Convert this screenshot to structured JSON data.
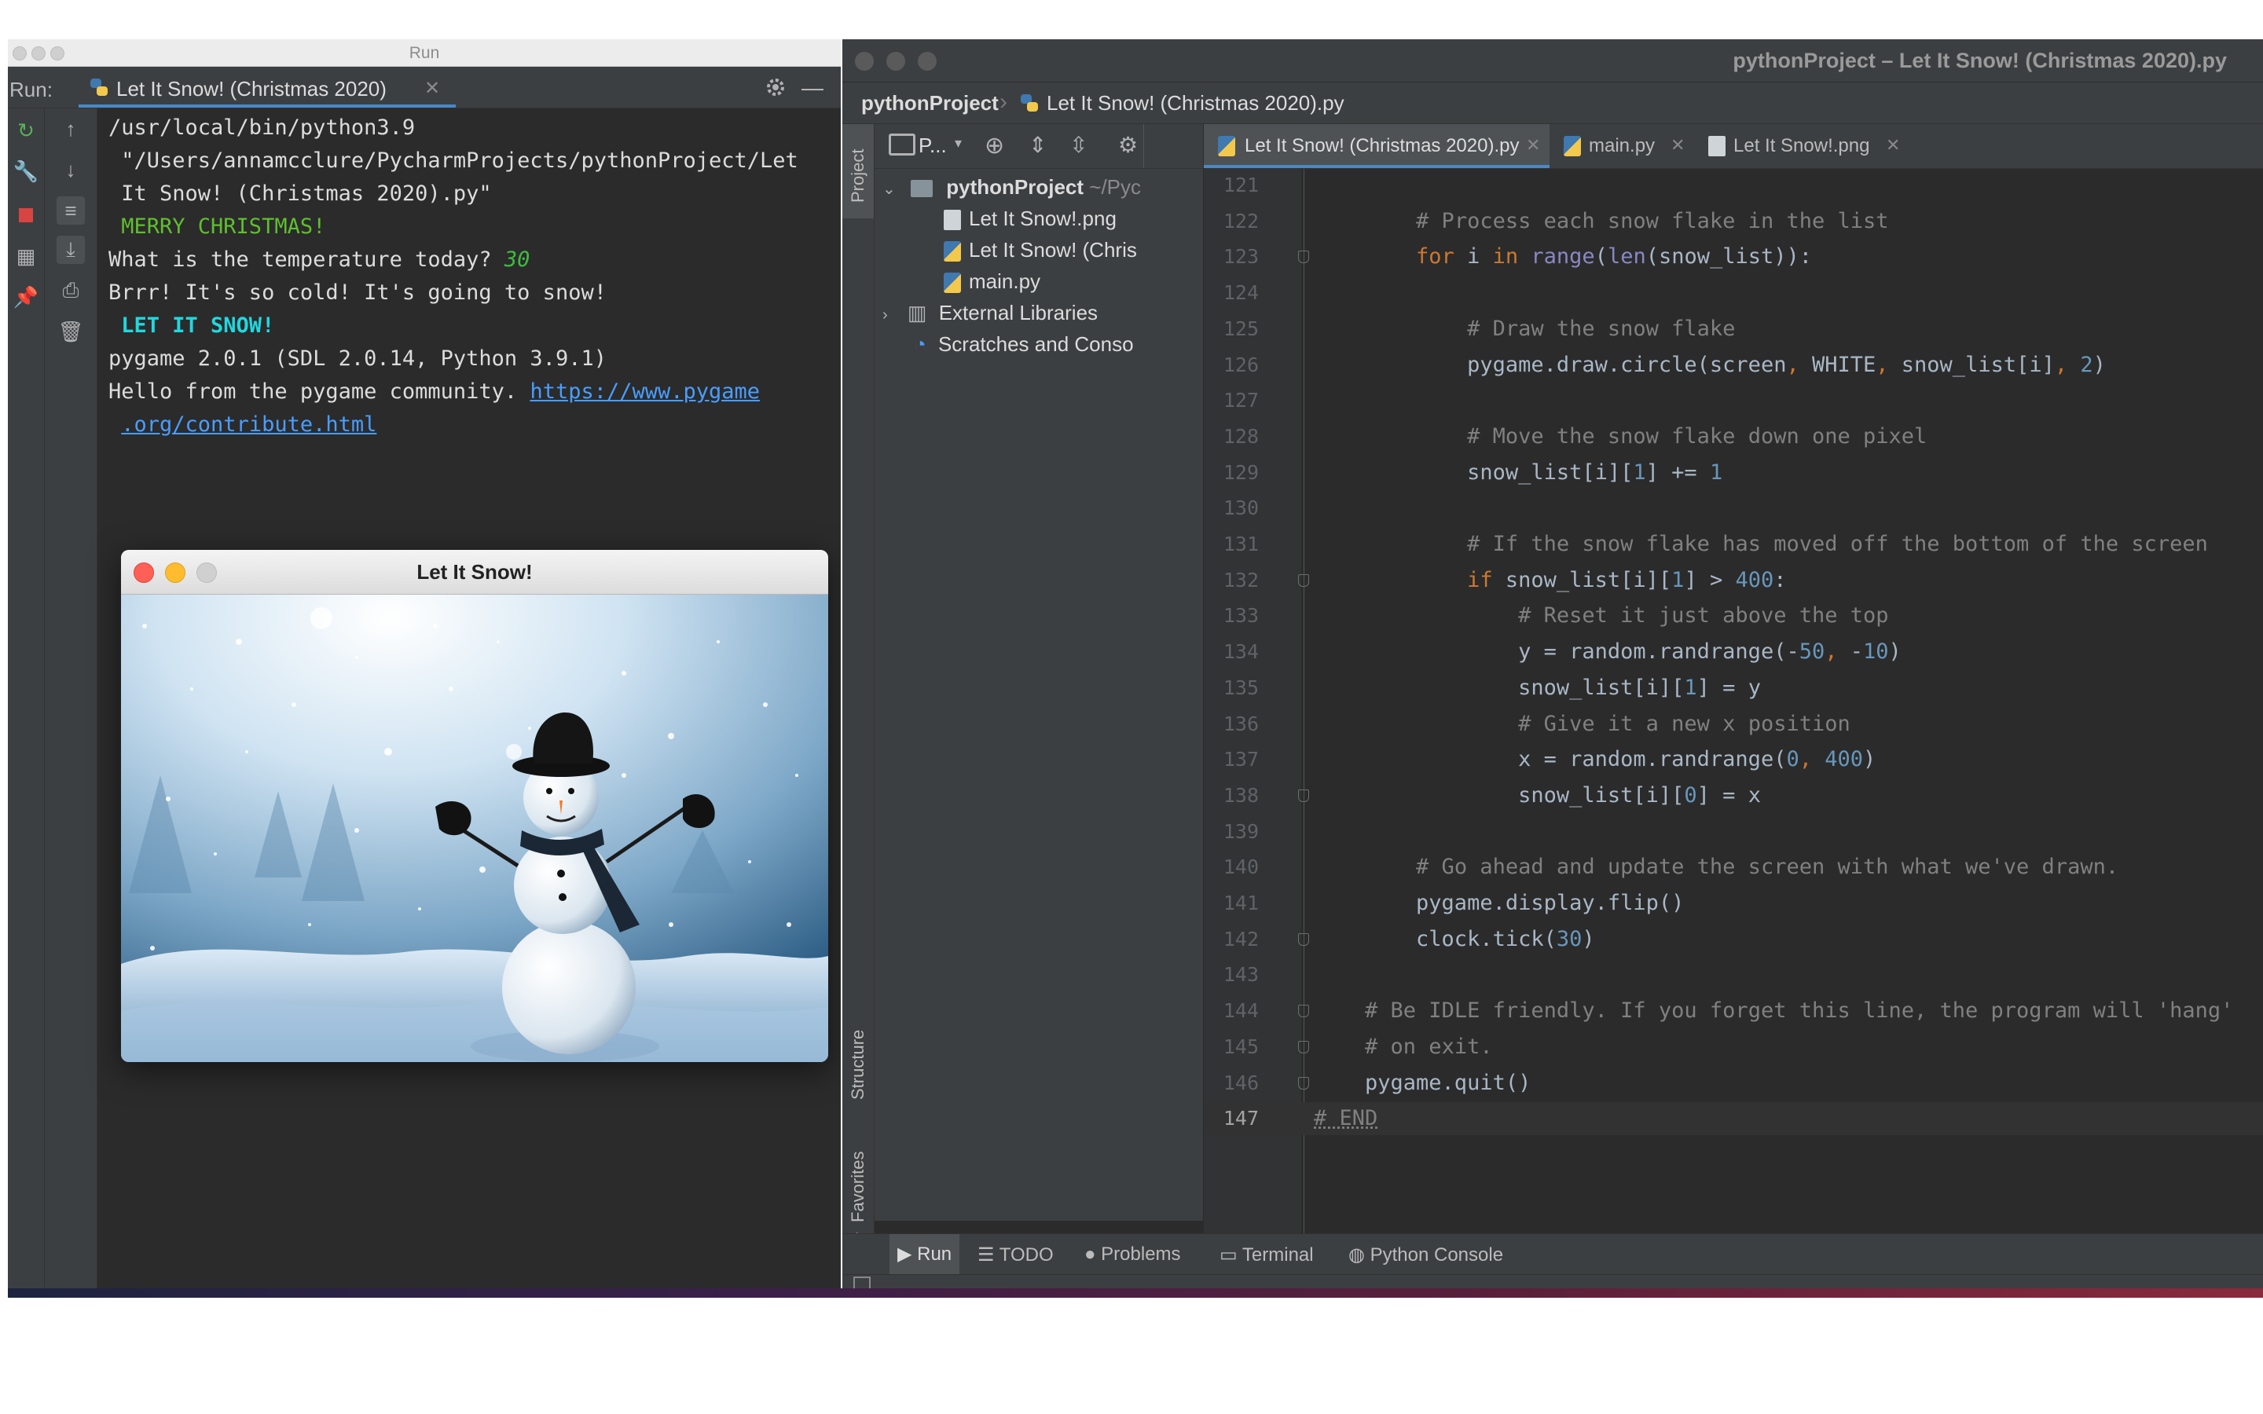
{
  "run_window": {
    "title": "Run",
    "run_label": "Run:",
    "tab_label": "Let It Snow! (Christmas 2020)",
    "console_lines": [
      {
        "text": "/usr/local/bin/python3.9",
        "style": "normal"
      },
      {
        "text": " \"/Users/annamcclure/PycharmProjects/pythonProject/Let",
        "style": "normal"
      },
      {
        "text": " It Snow! (Christmas 2020).py\"",
        "style": "normal"
      },
      {
        "text": " MERRY CHRISTMAS!",
        "style": "green"
      },
      {
        "text": "What is the temperature today? ",
        "style": "normal",
        "input": "30"
      },
      {
        "text": "Brrr! It's so cold! It's going to snow!",
        "style": "normal"
      },
      {
        "text": " LET IT SNOW!",
        "style": "cyan"
      },
      {
        "text": "pygame 2.0.1 (SDL 2.0.14, Python 3.9.1)",
        "style": "normal"
      },
      {
        "text": "Hello from the pygame community. ",
        "style": "normal",
        "link": "https://www.pygame"
      },
      {
        "text": " ",
        "style": "normal",
        "link": ".org/contribute.html"
      }
    ]
  },
  "pygame_window": {
    "title": "Let It Snow!"
  },
  "ide": {
    "title": "pythonProject – Let It Snow! (Christmas 2020).py",
    "breadcrumb": {
      "project": "pythonProject",
      "file": "Let It Snow! (Christmas 2020).py"
    },
    "project_panel": {
      "selector": "P...",
      "root": "pythonProject",
      "root_path": "~/Pyc",
      "files": [
        "Let It Snow!.png",
        "Let It Snow! (Chris",
        "main.py"
      ],
      "external": "External Libraries",
      "scratches": "Scratches and Conso"
    },
    "side_tabs": {
      "project": "Project",
      "structure": "Structure",
      "favorites": "Favorites"
    },
    "editor_tabs": [
      "Let It Snow! (Christmas 2020).py",
      "main.py",
      "Let It Snow!.png"
    ],
    "code_lines": [
      {
        "n": "121",
        "html": ""
      },
      {
        "n": "122",
        "html": "        <span class='cm'># Process each snow flake in the list</span>"
      },
      {
        "n": "123",
        "html": "        <span class='kw'>for</span> i <span class='kw'>in</span> <span class='bi'>range</span>(<span class='bi'>len</span>(snow_list)):"
      },
      {
        "n": "124",
        "html": ""
      },
      {
        "n": "125",
        "html": "            <span class='cm'># Draw the snow flake</span>"
      },
      {
        "n": "126",
        "html": "            pygame.draw.circle(screen<span class='kw'>,</span> WHITE<span class='kw'>,</span> snow_list[i]<span class='kw'>,</span> <span class='num'>2</span>)"
      },
      {
        "n": "127",
        "html": ""
      },
      {
        "n": "128",
        "html": "            <span class='cm'># Move the snow flake down one pixel</span>"
      },
      {
        "n": "129",
        "html": "            snow_list[i][<span class='num'>1</span>] += <span class='num'>1</span>"
      },
      {
        "n": "130",
        "html": ""
      },
      {
        "n": "131",
        "html": "            <span class='cm'># If the snow flake has moved off the bottom of the screen</span>"
      },
      {
        "n": "132",
        "html": "            <span class='kw'>if</span> snow_list[i][<span class='num'>1</span>] &gt; <span class='num'>400</span>:"
      },
      {
        "n": "133",
        "html": "                <span class='cm'># Reset it just above the top</span>"
      },
      {
        "n": "134",
        "html": "                y = random.randrange(-<span class='num'>50</span><span class='kw'>,</span> -<span class='num'>10</span>)"
      },
      {
        "n": "135",
        "html": "                snow_list[i][<span class='num'>1</span>] = y"
      },
      {
        "n": "136",
        "html": "                <span class='cm'># Give it a new x position</span>"
      },
      {
        "n": "137",
        "html": "                x = random.randrange(<span class='num'>0</span><span class='kw'>,</span> <span class='num'>400</span>)"
      },
      {
        "n": "138",
        "html": "                snow_list[i][<span class='num'>0</span>] = x"
      },
      {
        "n": "139",
        "html": ""
      },
      {
        "n": "140",
        "html": "        <span class='cm'># Go ahead and update the screen with what we've drawn.</span>"
      },
      {
        "n": "141",
        "html": "        pygame.display.flip()"
      },
      {
        "n": "142",
        "html": "        clock.tick(<span class='num'>30</span>)"
      },
      {
        "n": "143",
        "html": ""
      },
      {
        "n": "144",
        "html": "    <span class='cm'># Be IDLE friendly. If you forget this line, the program will 'hang'</span>"
      },
      {
        "n": "145",
        "html": "    <span class='cm'># on exit.</span>"
      },
      {
        "n": "146",
        "html": "    pygame.quit()"
      },
      {
        "n": "147",
        "html": "<span class='cm' style='text-decoration:underline dotted'># END</span>"
      }
    ],
    "bottom_tabs": [
      "Run",
      "TODO",
      "Problems",
      "Terminal",
      "Python Console"
    ]
  }
}
